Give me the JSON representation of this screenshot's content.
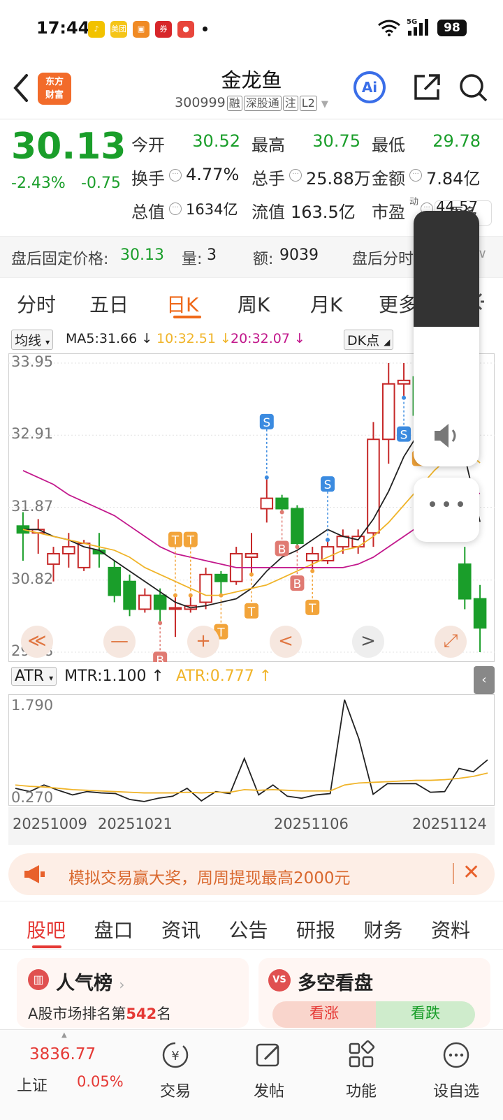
{
  "status": {
    "time": "17:44",
    "battery": "98",
    "network": "5G",
    "app_icons": [
      {
        "name": "tiktok-icon",
        "label": "♪",
        "color": "#f2c200"
      },
      {
        "name": "meituan-icon",
        "label": "美团",
        "color": "#f5c518"
      },
      {
        "name": "app-icon",
        "label": "▣",
        "color": "#f08a24"
      },
      {
        "name": "app-icon-red",
        "label": "券",
        "color": "#d7262a"
      },
      {
        "name": "record-icon",
        "label": "●",
        "color": "#e8463c"
      }
    ]
  },
  "header": {
    "logo_line1": "东方",
    "logo_line2": "财富",
    "title": "金龙鱼",
    "code": "300999",
    "tags": [
      "融",
      "深股通",
      "注",
      "L2"
    ]
  },
  "quote": {
    "price": "30.13",
    "change_pct": "-2.43%",
    "change": "-0.75",
    "fields": [
      {
        "label": "今开",
        "value": "30.52",
        "color": "down"
      },
      {
        "label": "最高",
        "value": "30.75",
        "color": "down"
      },
      {
        "label": "最低",
        "value": "29.78",
        "color": "down"
      },
      {
        "label": "换手",
        "value": "4.77%",
        "color": "plain"
      },
      {
        "label": "总手",
        "value": "25.88万",
        "color": "plain"
      },
      {
        "label": "金额",
        "value": "7.84亿",
        "color": "plain"
      },
      {
        "label": "总值",
        "value": "1634亿",
        "color": "plain"
      },
      {
        "label": "流值",
        "value": "163.5亿",
        "color": "plain"
      },
      {
        "label": "市盈",
        "value": "44.57",
        "color": "plain",
        "sup": "动"
      }
    ],
    "more": "更多"
  },
  "after_hours": {
    "price_label": "盘后固定价格:",
    "price": "30.13",
    "vol_label": "量:",
    "vol": "3",
    "amt_label": "额:",
    "amt": "9039",
    "time_label": "盘后分时"
  },
  "tabs": [
    "分时",
    "五日",
    "日K",
    "周K",
    "月K",
    "更多"
  ],
  "active_tab": "日K",
  "indicators": {
    "ma_selector": "均线",
    "ma5": "MA5:31.66",
    "ma10": "10:32.51",
    "ma20": "20:32.07",
    "dk": "DK点",
    "ma5_color": "#222222",
    "ma10_color": "#f0b429",
    "ma20_color": "#c2188c"
  },
  "kline_axis": [
    "33.95",
    "32.91",
    "31.87",
    "30.82",
    "29.78"
  ],
  "atr": {
    "selector": "ATR",
    "mtr": "MTR:1.100",
    "atr": "ATR:0.777",
    "axis_top": "1.790",
    "axis_bottom": "0.270"
  },
  "dates": [
    "20251009",
    "20251021",
    "20251106",
    "20251124"
  ],
  "chart_data": [
    {
      "type": "candlestick",
      "title": "",
      "ylim": [
        29.78,
        33.95
      ],
      "candles": [
        {
          "o": 31.6,
          "c": 31.5,
          "h": 31.8,
          "l": 31.1
        },
        {
          "o": 31.5,
          "c": 31.55,
          "h": 31.7,
          "l": 31.2
        },
        {
          "o": 31.05,
          "c": 31.2,
          "h": 31.3,
          "l": 30.8
        },
        {
          "o": 31.2,
          "c": 31.3,
          "h": 31.5,
          "l": 31.0
        },
        {
          "o": 31.0,
          "c": 31.35,
          "h": 31.4,
          "l": 30.95
        },
        {
          "o": 31.25,
          "c": 31.2,
          "h": 31.5,
          "l": 31.0
        },
        {
          "o": 31.0,
          "c": 30.6,
          "h": 31.1,
          "l": 30.5
        },
        {
          "o": 30.8,
          "c": 30.4,
          "h": 30.9,
          "l": 30.3
        },
        {
          "o": 30.4,
          "c": 30.6,
          "h": 30.7,
          "l": 30.35
        },
        {
          "o": 30.6,
          "c": 30.4,
          "h": 30.7,
          "l": 30.2
        },
        {
          "o": 30.4,
          "c": 30.42,
          "h": 30.6,
          "l": 30.0
        },
        {
          "o": 30.4,
          "c": 30.45,
          "h": 30.6,
          "l": 30.35
        },
        {
          "o": 30.5,
          "c": 30.9,
          "h": 31.0,
          "l": 30.4
        },
        {
          "o": 30.9,
          "c": 30.8,
          "h": 30.95,
          "l": 30.6
        },
        {
          "o": 30.8,
          "c": 31.2,
          "h": 31.3,
          "l": 30.75
        },
        {
          "o": 31.15,
          "c": 31.2,
          "h": 31.5,
          "l": 30.9
        },
        {
          "o": 31.85,
          "c": 32.0,
          "h": 32.3,
          "l": 31.65
        },
        {
          "o": 32.0,
          "c": 31.85,
          "h": 32.05,
          "l": 31.8
        },
        {
          "o": 31.85,
          "c": 31.35,
          "h": 31.9,
          "l": 31.3
        },
        {
          "o": 31.1,
          "c": 31.2,
          "h": 31.3,
          "l": 30.95
        },
        {
          "o": 31.1,
          "c": 31.3,
          "h": 31.4,
          "l": 31.05
        },
        {
          "o": 31.3,
          "c": 31.45,
          "h": 31.55,
          "l": 31.2
        },
        {
          "o": 31.3,
          "c": 31.45,
          "h": 31.55,
          "l": 31.2
        },
        {
          "o": 31.5,
          "c": 32.85,
          "h": 33.1,
          "l": 31.3
        },
        {
          "o": 32.85,
          "c": 33.65,
          "h": 33.95,
          "l": 32.5
        },
        {
          "o": 33.65,
          "c": 33.7,
          "h": 33.95,
          "l": 33.45
        },
        {
          "o": 33.75,
          "c": 33.2,
          "h": 33.85,
          "l": 33.1
        },
        {
          "o": 33.25,
          "c": 32.95,
          "h": 33.75,
          "l": 32.8
        },
        {
          "o": 32.95,
          "c": 32.75,
          "h": 33.15,
          "l": 32.5
        },
        {
          "o": 31.05,
          "c": 30.55,
          "h": 31.3,
          "l": 30.4
        },
        {
          "o": 30.55,
          "c": 30.13,
          "h": 30.75,
          "l": 29.78
        }
      ],
      "series": [
        {
          "name": "MA5",
          "values": [
            31.55,
            31.55,
            31.45,
            31.4,
            31.3,
            31.25,
            31.1,
            30.95,
            30.8,
            30.65,
            30.5,
            30.42,
            30.45,
            30.5,
            30.55,
            30.7,
            30.95,
            31.15,
            31.25,
            31.4,
            31.55,
            31.45,
            31.4,
            31.7,
            32.1,
            32.6,
            32.95,
            33.15,
            33.15,
            32.6,
            31.66
          ]
        },
        {
          "name": "MA10",
          "values": [
            31.55,
            31.5,
            31.45,
            31.4,
            31.35,
            31.3,
            31.25,
            31.15,
            31.0,
            30.9,
            30.8,
            30.7,
            30.6,
            30.6,
            30.65,
            30.7,
            30.75,
            30.85,
            30.95,
            31.05,
            31.15,
            31.25,
            31.3,
            31.45,
            31.65,
            31.9,
            32.15,
            32.4,
            32.6,
            32.7,
            32.51
          ]
        },
        {
          "name": "MA20",
          "values": [
            32.4,
            32.3,
            32.2,
            32.05,
            31.95,
            31.85,
            31.75,
            31.6,
            31.45,
            31.3,
            31.2,
            31.15,
            31.1,
            31.05,
            31.0,
            31.0,
            31.0,
            31.0,
            31.0,
            31.0,
            31.0,
            31.0,
            31.05,
            31.15,
            31.3,
            31.45,
            31.6,
            31.75,
            31.9,
            32.05,
            32.07
          ]
        }
      ],
      "markers": [
        {
          "i": 9,
          "label": "B",
          "pos": "below"
        },
        {
          "i": 10,
          "label": "T",
          "pos": "above"
        },
        {
          "i": 11,
          "label": "T",
          "pos": "above"
        },
        {
          "i": 13,
          "label": "T",
          "pos": "below"
        },
        {
          "i": 15,
          "label": "T",
          "pos": "below"
        },
        {
          "i": 16,
          "label": "S",
          "pos": "above"
        },
        {
          "i": 17,
          "label": "B",
          "pos": "below"
        },
        {
          "i": 18,
          "label": "B",
          "pos": "below"
        },
        {
          "i": 19,
          "label": "T",
          "pos": "below"
        },
        {
          "i": 20,
          "label": "S",
          "pos": "above"
        },
        {
          "i": 25,
          "label": "S",
          "pos": "below"
        },
        {
          "i": 26,
          "label": "T",
          "pos": "below"
        }
      ]
    },
    {
      "type": "line",
      "title": "",
      "ylim": [
        0.27,
        1.79
      ],
      "series": [
        {
          "name": "MTR",
          "values": [
            0.45,
            0.4,
            0.5,
            0.42,
            0.35,
            0.4,
            0.38,
            0.37,
            0.28,
            0.25,
            0.3,
            0.33,
            0.45,
            0.26,
            0.4,
            0.37,
            0.9,
            0.35,
            0.5,
            0.33,
            0.3,
            0.35,
            0.37,
            1.79,
            1.2,
            0.36,
            0.52,
            0.52,
            0.52,
            0.39,
            0.4,
            0.75,
            0.7,
            0.88
          ]
        },
        {
          "name": "ATR",
          "values": [
            0.5,
            0.48,
            0.47,
            0.45,
            0.43,
            0.42,
            0.41,
            0.4,
            0.39,
            0.38,
            0.38,
            0.38,
            0.39,
            0.38,
            0.39,
            0.39,
            0.43,
            0.42,
            0.43,
            0.42,
            0.41,
            0.41,
            0.41,
            0.5,
            0.53,
            0.54,
            0.55,
            0.56,
            0.57,
            0.57,
            0.58,
            0.6,
            0.63,
            0.68
          ]
        }
      ]
    }
  ],
  "nav_buttons": [
    "≪",
    "—",
    "+",
    "<",
    ">",
    "⤢"
  ],
  "banner": {
    "text": "模拟交易赢大奖，周周提现最高2000元"
  },
  "section_tabs": [
    "股吧",
    "盘口",
    "资讯",
    "公告",
    "研报",
    "财务",
    "资料"
  ],
  "active_section": "股吧",
  "cards": {
    "left_title": "人气榜",
    "left_sub_prefix": "A股市场排名第",
    "left_rank": "542",
    "left_sub_suffix": "名",
    "right_title": "多空看盘",
    "bull": "看涨",
    "bear": "看跌"
  },
  "bottom_nav": {
    "index_value": "3836.77",
    "index_name": "上证",
    "index_change": "0.05%",
    "items": [
      "交易",
      "发帖",
      "功能",
      "设自选"
    ]
  }
}
